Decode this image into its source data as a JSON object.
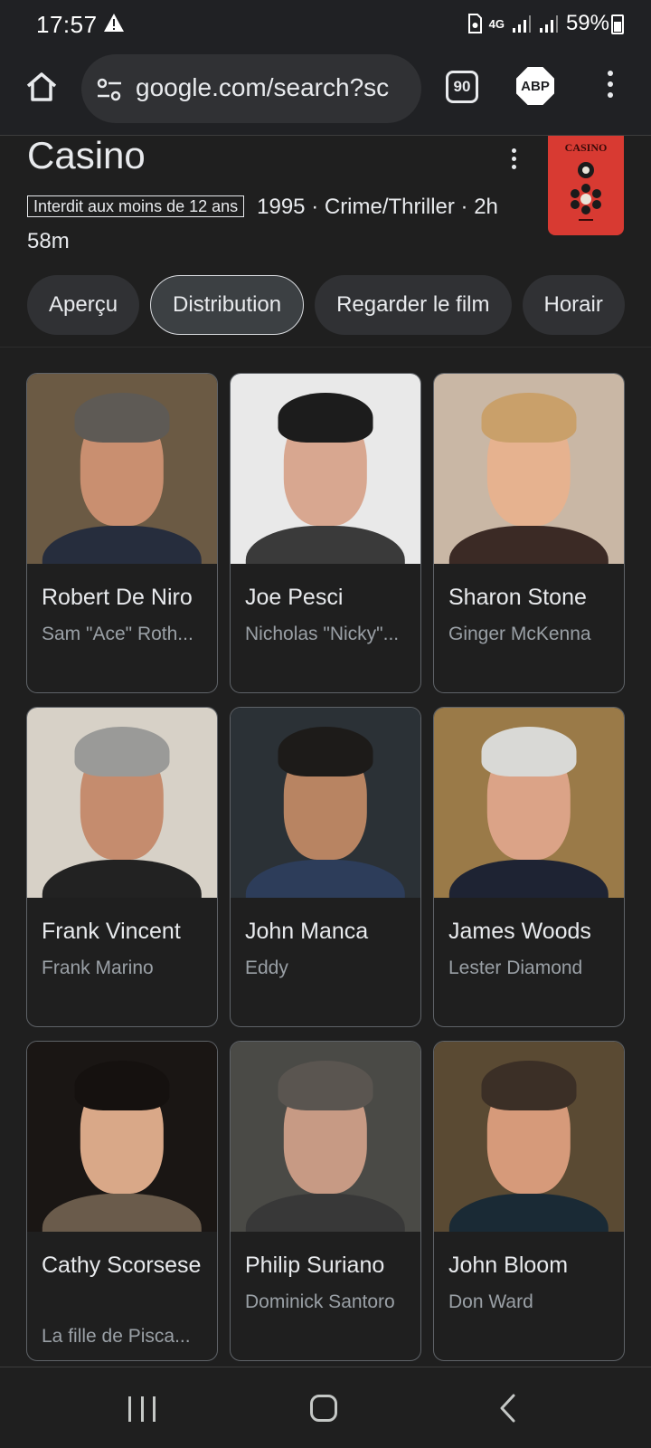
{
  "status_bar": {
    "time": "17:57",
    "network": "4G",
    "battery": "59%",
    "battery_level": 0.59
  },
  "browser": {
    "url": "google.com/search?sc",
    "tab_count": "90",
    "adblock_label": "ABP"
  },
  "movie": {
    "title": "Casino",
    "rating": "Interdit aux moins de 12 ans",
    "meta": "1995 · Crime/Thriller · 2h 58m",
    "poster_title": "CASINO"
  },
  "tabs": [
    {
      "label": "Aperçu",
      "active": false
    },
    {
      "label": "Distribution",
      "active": true
    },
    {
      "label": "Regarder le film",
      "active": false
    },
    {
      "label": "Horair",
      "active": false
    }
  ],
  "cast": [
    {
      "name": "Robert De Niro",
      "role": "Sam \"Ace\" Roth...",
      "bg": "#6b5a44",
      "skin": "#c98f70",
      "hair": "#5e5a55",
      "top": "#262d3d"
    },
    {
      "name": "Joe Pesci",
      "role": "Nicholas \"Nicky\"...",
      "bg": "#e9e9e9",
      "skin": "#d8a790",
      "hair": "#1c1c1c",
      "top": "#3a3a3a"
    },
    {
      "name": "Sharon Stone",
      "role": "Ginger McKenna",
      "bg": "#c9b7a5",
      "skin": "#e6b28f",
      "hair": "#c9a06a",
      "top": "#3b2a25"
    },
    {
      "name": "Frank Vincent",
      "role": "Frank Marino",
      "bg": "#d7d1c7",
      "skin": "#c58c6e",
      "hair": "#9a9a98",
      "top": "#222"
    },
    {
      "name": "John Manca",
      "role": "Eddy",
      "bg": "#2b3136",
      "skin": "#b88462",
      "hair": "#1d1b19",
      "top": "#2d3d5a"
    },
    {
      "name": "James Woods",
      "role": "Lester Diamond",
      "bg": "#9a7a48",
      "skin": "#dba387",
      "hair": "#d9d9d6",
      "top": "#1e2333"
    },
    {
      "name": "Cathy Scorsese",
      "role": "La fille de Pisca...",
      "bg": "#1a1614",
      "skin": "#d9a888",
      "hair": "#15110f",
      "top": "#6a5b4b"
    },
    {
      "name": "Philip Suriano",
      "role": "Dominick Santoro",
      "bg": "#4a4a46",
      "skin": "#c79a84",
      "hair": "#5a5550",
      "top": "#383838"
    },
    {
      "name": "John Bloom",
      "role": "Don Ward",
      "bg": "#5a4a33",
      "skin": "#d69a7a",
      "hair": "#3b2f26",
      "top": "#1a2a35"
    }
  ],
  "icons": {
    "home": "home-icon",
    "site_settings": "tune-icon",
    "menu": "more-vert-icon",
    "recents": "recent-apps-icon",
    "nav_home": "nav-home-icon",
    "back": "back-icon"
  }
}
